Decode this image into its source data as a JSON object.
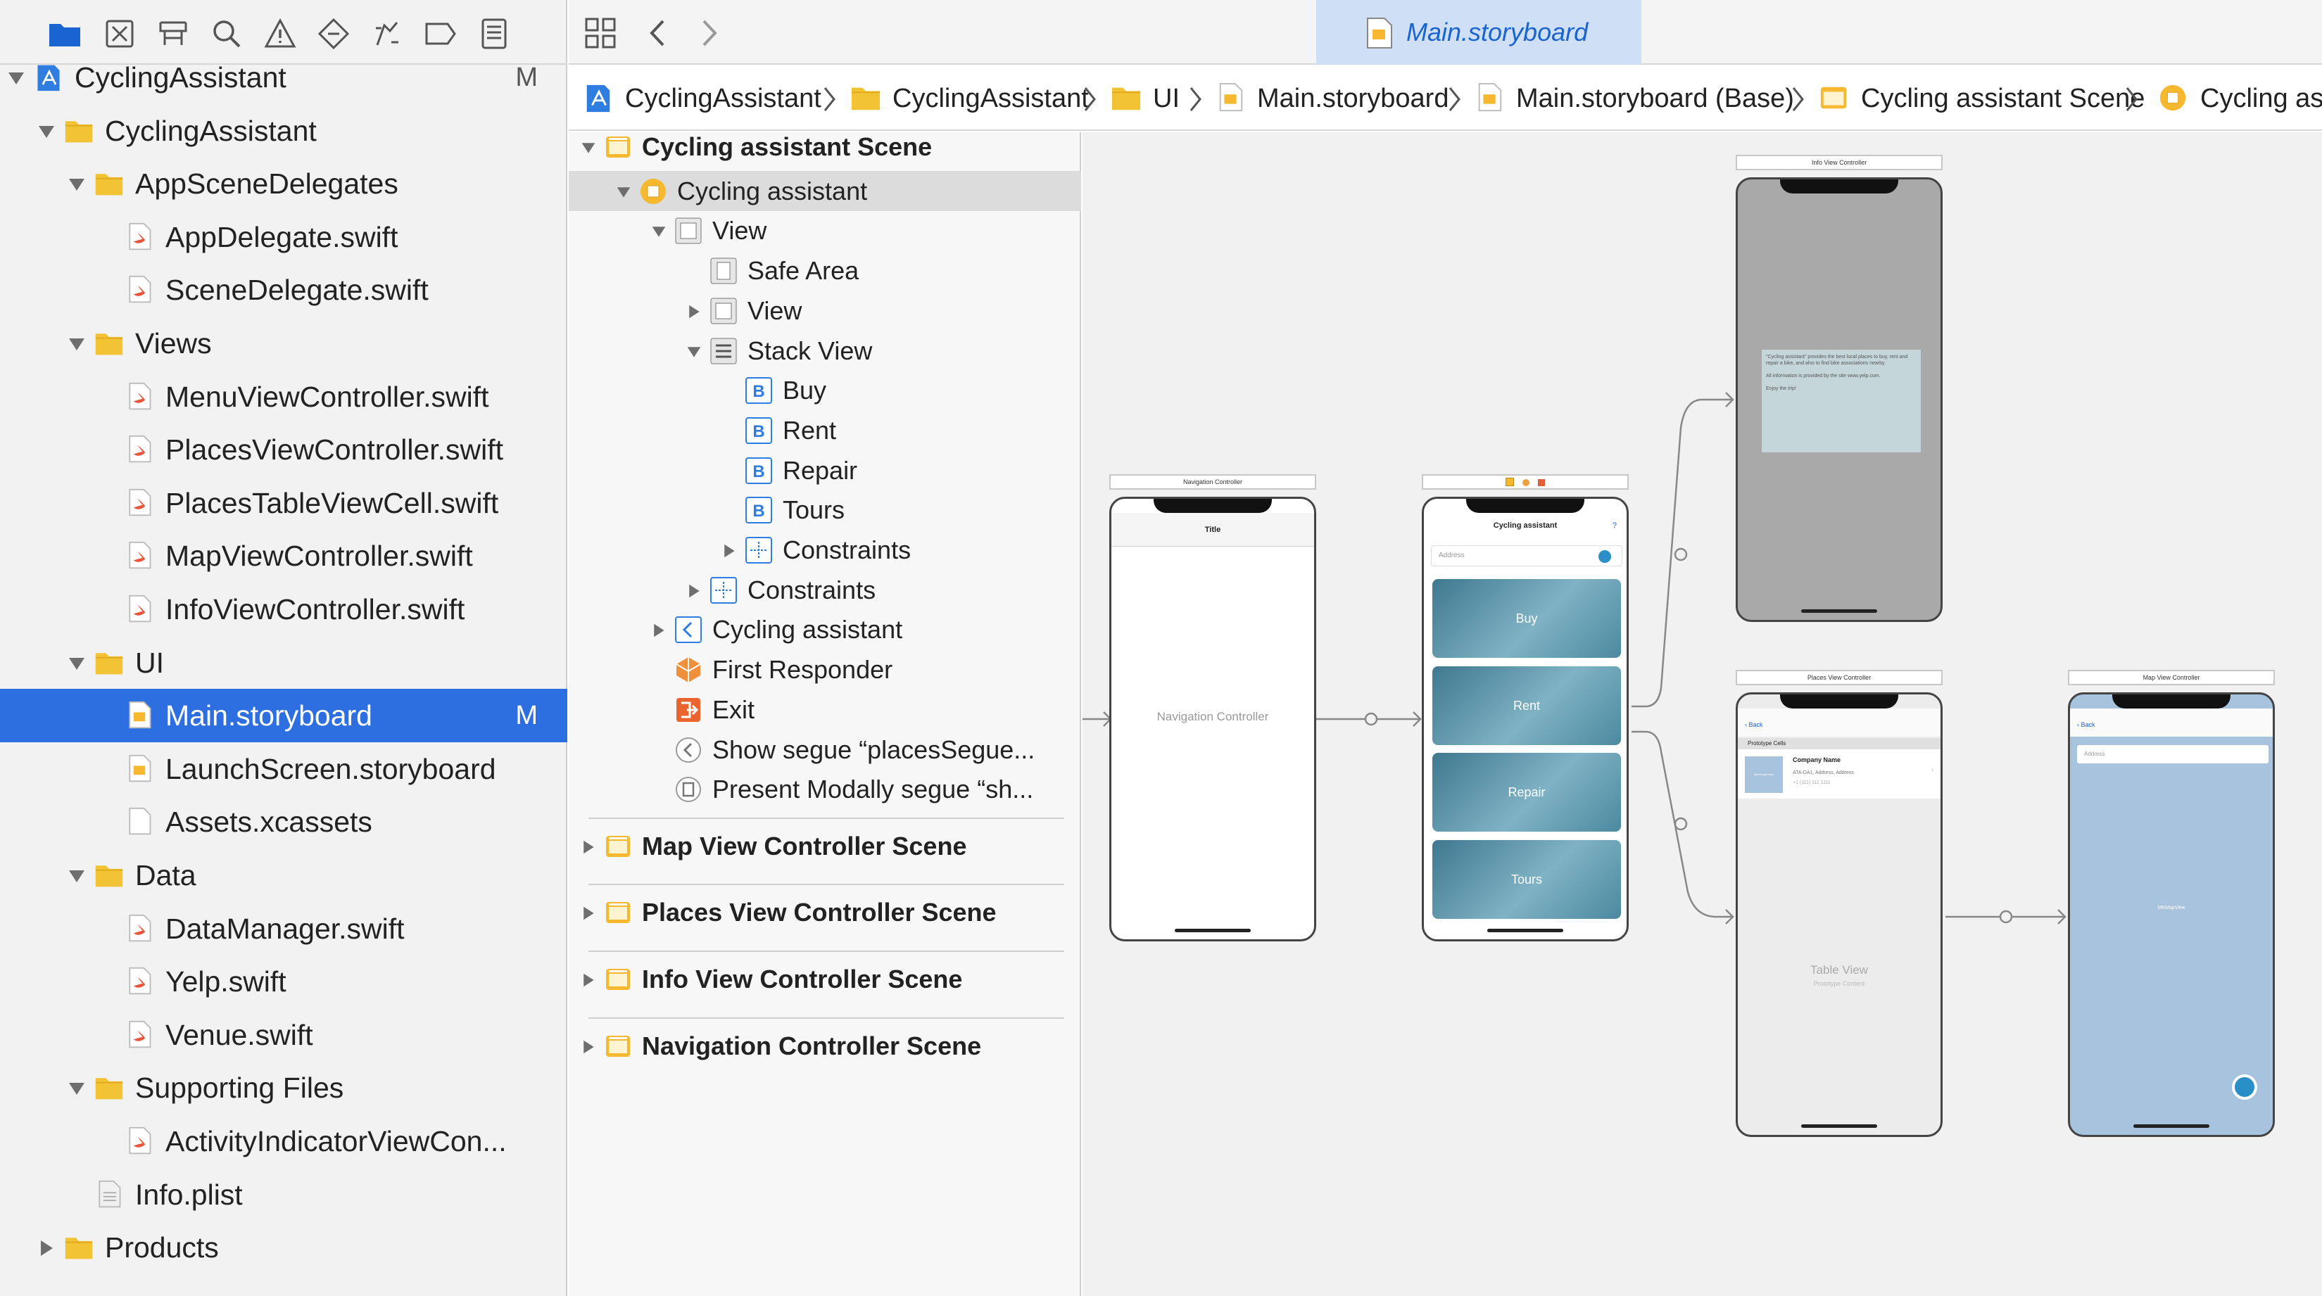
{
  "navigator": {
    "items": [
      {
        "label": "CyclingAssistant",
        "badge": "M"
      },
      {
        "label": "CyclingAssistant"
      },
      {
        "label": "AppSceneDelegates"
      },
      {
        "label": "AppDelegate.swift"
      },
      {
        "label": "SceneDelegate.swift"
      },
      {
        "label": "Views"
      },
      {
        "label": "MenuViewController.swift"
      },
      {
        "label": "PlacesViewController.swift"
      },
      {
        "label": "PlacesTableViewCell.swift"
      },
      {
        "label": "MapViewController.swift"
      },
      {
        "label": "InfoViewController.swift"
      },
      {
        "label": "UI"
      },
      {
        "label": "Main.storyboard",
        "badge": "M"
      },
      {
        "label": "LaunchScreen.storyboard"
      },
      {
        "label": "Assets.xcassets"
      },
      {
        "label": "Data"
      },
      {
        "label": "DataManager.swift"
      },
      {
        "label": "Yelp.swift"
      },
      {
        "label": "Venue.swift"
      },
      {
        "label": "Supporting Files"
      },
      {
        "label": "ActivityIndicatorViewCon..."
      },
      {
        "label": "Info.plist"
      },
      {
        "label": "Products"
      }
    ]
  },
  "tab": {
    "label": "Main.storyboard"
  },
  "jumpbar": {
    "crumbs": [
      "CyclingAssistant",
      "CyclingAssistant",
      "UI",
      "Main.storyboard",
      "Main.storyboard (Base)",
      "Cycling assistant Scene",
      "Cycling assistant"
    ]
  },
  "outline": {
    "rows": [
      {
        "label": "Cycling assistant Scene"
      },
      {
        "label": "Cycling assistant"
      },
      {
        "label": "View"
      },
      {
        "label": "Safe Area"
      },
      {
        "label": "View"
      },
      {
        "label": "Stack View"
      },
      {
        "label": "Buy"
      },
      {
        "label": "Rent"
      },
      {
        "label": "Repair"
      },
      {
        "label": "Tours"
      },
      {
        "label": "Constraints"
      },
      {
        "label": "Constraints"
      },
      {
        "label": "Cycling assistant"
      },
      {
        "label": "First Responder"
      },
      {
        "label": "Exit"
      },
      {
        "label": "Show segue “placesSegue..."
      },
      {
        "label": "Present Modally segue “sh..."
      }
    ],
    "scenes": [
      {
        "label": "Map View Controller Scene"
      },
      {
        "label": "Places View Controller Scene"
      },
      {
        "label": "Info View Controller Scene"
      },
      {
        "label": "Navigation Controller Scene"
      }
    ]
  },
  "canvas": {
    "nav_controller": {
      "label": "Navigation Controller",
      "title": "Title",
      "body": "Navigation Controller"
    },
    "menu": {
      "title": "Cycling assistant",
      "help": "?",
      "address_placeholder": "Address",
      "buttons": [
        "Buy",
        "Rent",
        "Repair",
        "Tours"
      ]
    },
    "info": {
      "label": "Info View Controller",
      "text1": "\"Cycling assistant\" provides the best local places to buy, rent and repair a bike, and also to find bike associations nearby.",
      "text2": "All information is provided by the site www.yelp.com.",
      "text3": "Enjoy the trip!"
    },
    "places": {
      "label": "Places View Controller",
      "back": "Back",
      "section": "Prototype Cells",
      "company": "Company Name",
      "address": "ATA-DA1, Address, Address",
      "phone": "+1 (111) 111 1111",
      "table": "Table View",
      "content": "Prototype Content",
      "thumb": "MainImageView"
    },
    "map": {
      "label": "Map View Controller",
      "back": "Back",
      "address_placeholder": "Address",
      "mapview": "MKMapView"
    }
  },
  "colors": {
    "selection": "#2d6fe0",
    "folder": "#f2c335",
    "scene": "#f5b82e",
    "accent": "#1a64d2",
    "swift": "#e9543a"
  }
}
